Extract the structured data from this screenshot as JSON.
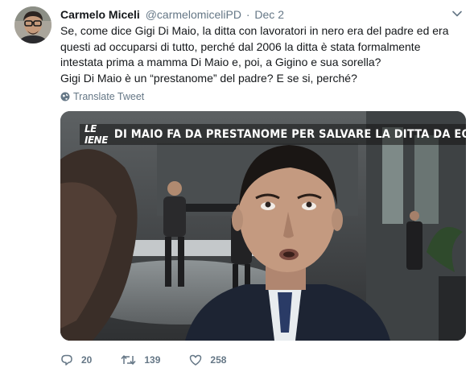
{
  "tweet": {
    "author_name": "Carmelo Miceli",
    "author_handle": "@carmelomiceliPD",
    "separator": "·",
    "date": "Dec 2",
    "text_lines": [
      "Se, come dice Gigi Di Maio, la ditta con lavoratori in nero era del padre ed era questi ad occuparsi di tutto, perché dal 2006 la ditta è stata formalmente intestata prima a mamma Di Maio e, poi, a Gigino e sua sorella?",
      "Gigi Di Maio è un “prestanome” del padre? E se si, perché?"
    ],
    "translate_label": "Translate Tweet",
    "media": {
      "logo_text": "LE IENE",
      "headline": "DI MAIO FA DA PRESTANOME PER SALVARE LA DITTA DA EQUITALIA?"
    },
    "actions": {
      "replies": "20",
      "retweets": "139",
      "likes": "258"
    },
    "icons": {
      "avatar": "avatar",
      "caret": "chevron-down-icon",
      "translate": "globe-icon",
      "reply": "reply-icon",
      "retweet": "retweet-icon",
      "like": "heart-icon"
    },
    "colors": {
      "text": "#14171a",
      "secondary": "#657786"
    }
  }
}
